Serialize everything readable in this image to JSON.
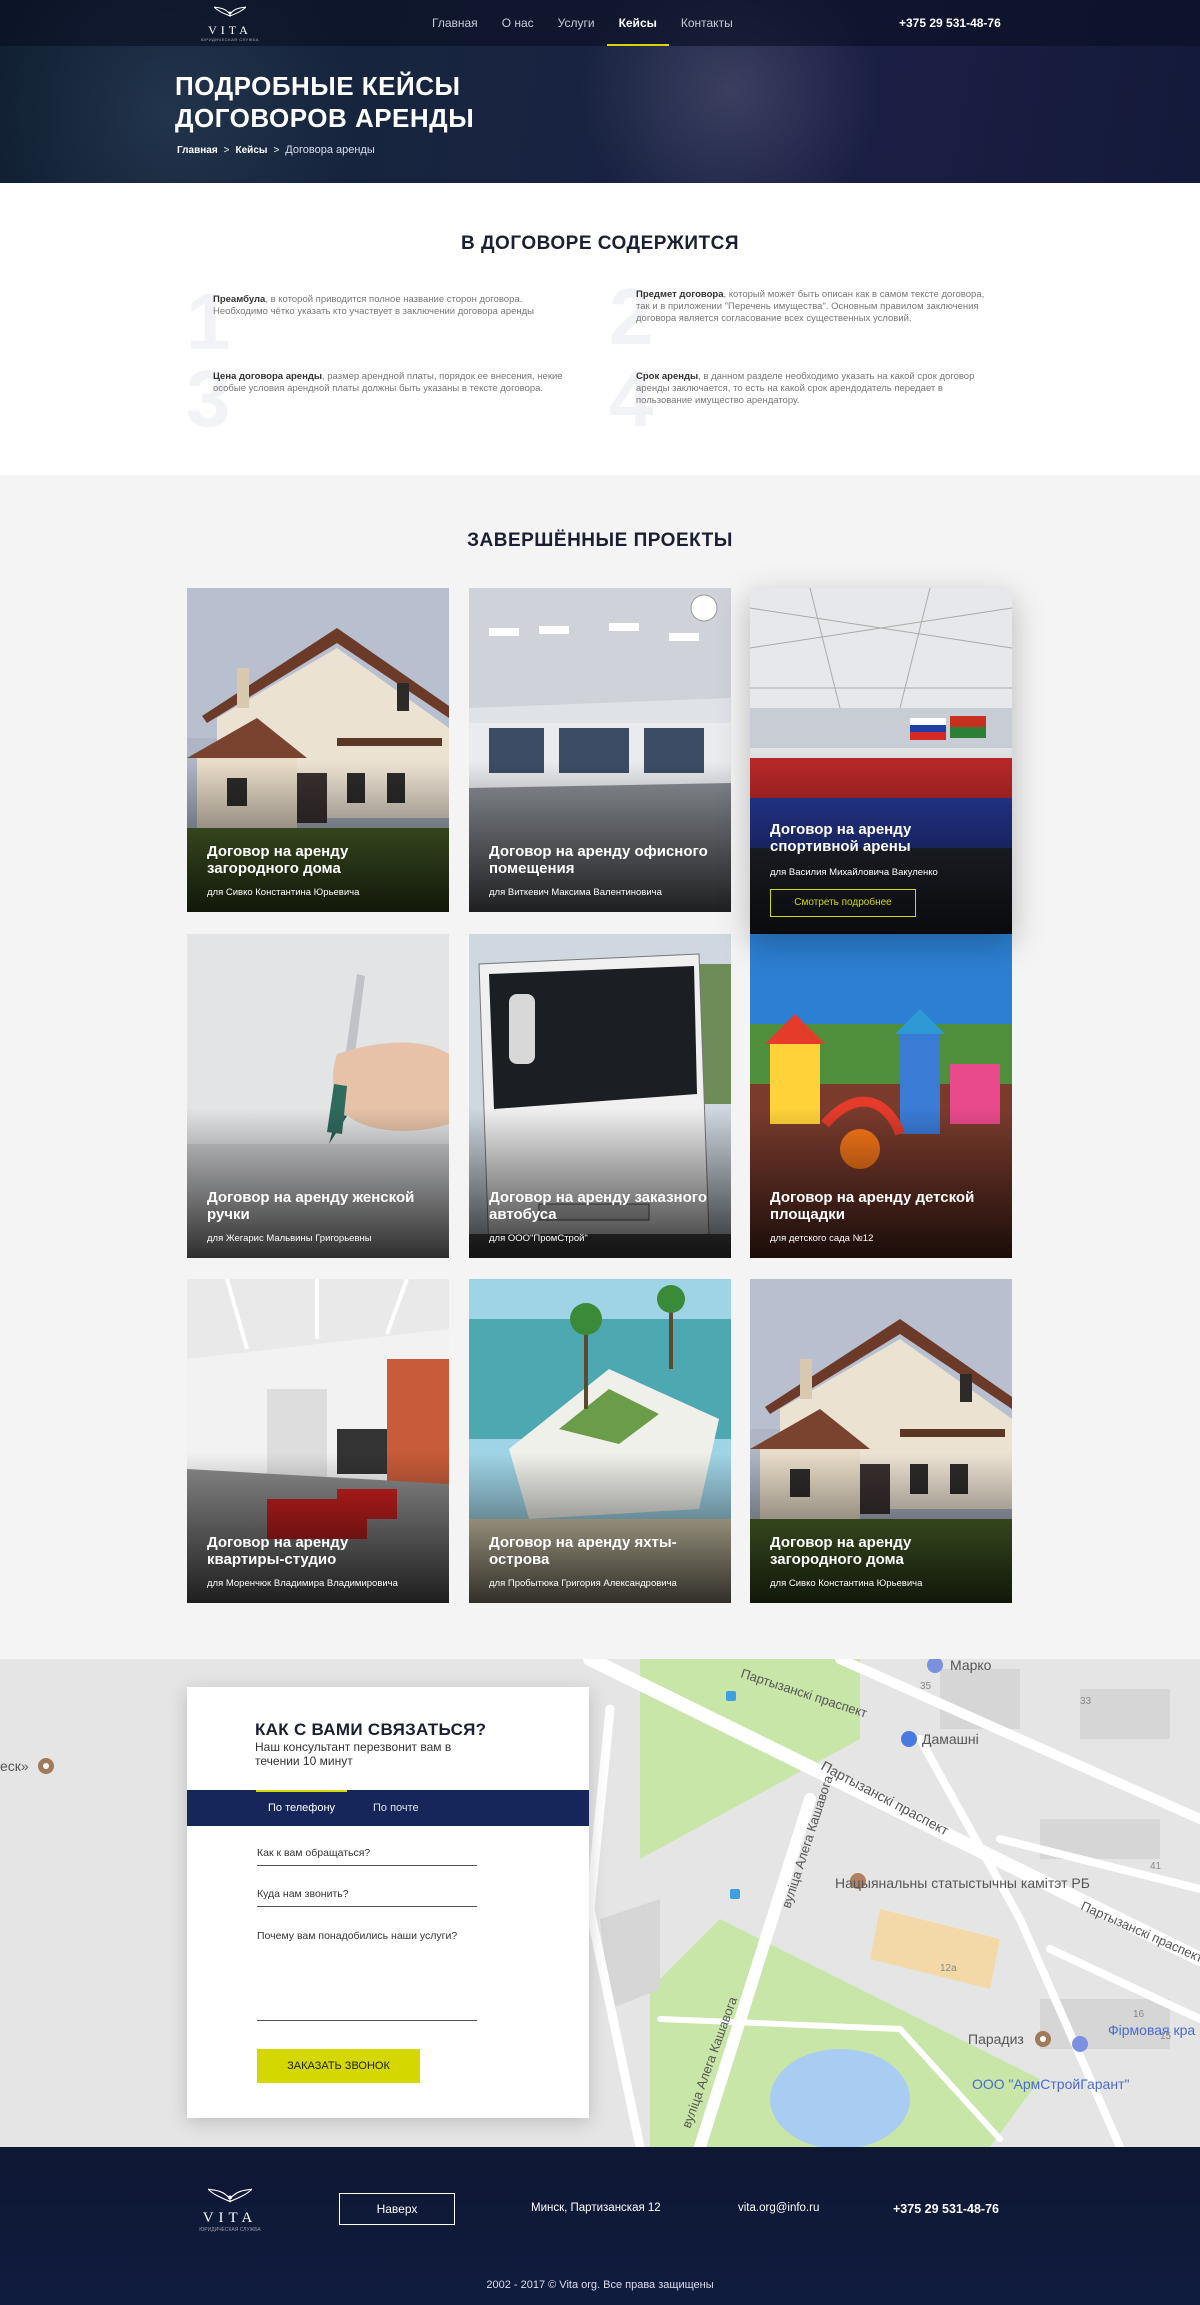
{
  "header": {
    "logo_word": "VITA",
    "logo_sub": "ЮРИДИЧЕСКАЯ СЛУЖБА",
    "nav": [
      "Главная",
      "О нас",
      "Услуги",
      "Кейсы",
      "Контакты"
    ],
    "active_nav": "Кейсы",
    "phone": "+375 29 531-48-76"
  },
  "hero": {
    "title_line1": "ПОДРОБНЫЕ КЕЙСЫ",
    "title_line2": "ДОГОВОРОВ АРЕНДЫ",
    "crumb_home": "Главная",
    "crumb_sep": ">",
    "crumb_cases": "Кейсы",
    "crumb_sep2": ">",
    "crumb_current": "Договора аренды"
  },
  "contains": {
    "title": "В ДОГОВОРЕ СОДЕРЖИТСЯ",
    "items": [
      {
        "num": "1",
        "bold": "Преамбула",
        "text": ", в которой приводится полное название сторон договора. Необходимо чётко указать кто участвует в заключении договора аренды"
      },
      {
        "num": "2",
        "bold": "Предмет договора",
        "text": ", который может быть описан как в самом тексте договора, так и в приложении \"Перечень имущества\". Основным правилом заключения договора является согласование всех существенных условий."
      },
      {
        "num": "3",
        "bold": "Цена договора аренды",
        "text": ", размер арендной платы, порядок ее внесения, некие особые условия арендной платы должны быть указаны в тексте договора."
      },
      {
        "num": "4",
        "bold": "Срок аренды",
        "text": ", в данном разделе необходимо указать на какой срок договор аренды заключается, то есть на какой срок арендодатель передает в пользование имущество арендатору."
      }
    ]
  },
  "projects": {
    "title": "ЗАВЕРШЁННЫЕ ПРОЕКТЫ",
    "more_label": "Смотреть подробнее",
    "cards": [
      {
        "title": "Договор на аренду загородного дома",
        "sub": "для Сивко Константина Юрьевича",
        "image": "country-house"
      },
      {
        "title": "Договор на аренду офисного помещения",
        "sub": "для Виткевич Максима Валентиновича",
        "image": "office-room"
      },
      {
        "title": "Договор на аренду спортивной арены",
        "sub": "для Василия Михайловича Вакуленко",
        "image": "sports-arena"
      },
      {
        "title": "Договор на аренду женской ручки",
        "sub": "для Жегарис Мальвины Григорьевны",
        "image": "hand-pen"
      },
      {
        "title": "Договор на аренду заказного автобуса",
        "sub": "для ООО\"ПромСтрой\"",
        "image": "bus"
      },
      {
        "title": "Договор на аренду детской площадки",
        "sub": "для детского сада №12",
        "image": "playground"
      },
      {
        "title": "Договор на аренду квартиры-студио",
        "sub": "для Моренчюк Владимира Владимировича",
        "image": "studio-apartment"
      },
      {
        "title": "Договор на аренду яхты-острова",
        "sub": "для Пробытюка Григория Александровича",
        "image": "yacht-island"
      },
      {
        "title": "Договор на аренду загородного дома",
        "sub": "для Сивко Константина Юрьевича",
        "image": "country-house"
      }
    ]
  },
  "contact": {
    "title": "КАК С ВАМИ СВЯЗАТЬСЯ?",
    "lead": "Наш консультант перезвонит вам в течении 10 минут",
    "tab_phone": "По телефону",
    "tab_mail": "По почте",
    "field_name": "Как к вам обращаться?",
    "field_phone": "Куда нам звонить?",
    "field_reason": "Почему вам понадобились наши услуги?",
    "submit": "ЗАКАЗАТЬ ЗВОНОК"
  },
  "map": {
    "labels": [
      "Марко",
      "Дамашні",
      "Партызанскі праспект",
      "Партызанскі праспект",
      "Партызанскі праспект",
      "вуліца Алега Кашавога",
      "вуліца Алега Кашавога",
      "Нацыянальны статыстычны камітэт РБ",
      "Парадиз",
      "ООО \"АрмСтройГарант\"",
      "Фірмовая кра",
      "еск»"
    ],
    "numbers": [
      "35",
      "33",
      "41",
      "12а",
      "16",
      "15"
    ]
  },
  "footer": {
    "logo_word": "VITA",
    "logo_sub": "ЮРИДИЧЕСКАЯ СЛУЖБА",
    "top_button": "Наверх",
    "address": "Минск, Партизанская 12",
    "email": "vita.org@info.ru",
    "phone": "+375 29 531-48-76",
    "copyright": "2002 - 2017  ©  Vita org. Все права защищены"
  }
}
